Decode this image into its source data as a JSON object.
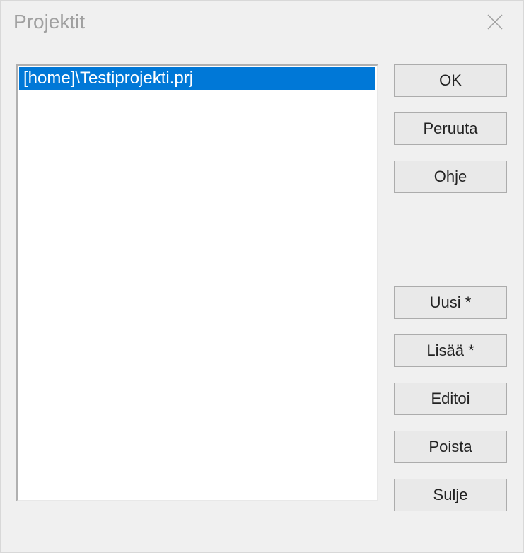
{
  "title": "Projektit",
  "list": {
    "items": [
      {
        "label": "[home]\\Testiprojekti.prj",
        "selected": true
      }
    ]
  },
  "buttons": {
    "ok": "OK",
    "cancel": "Peruuta",
    "help": "Ohje",
    "new": "Uusi *",
    "add": "Lisää *",
    "edit": "Editoi",
    "remove": "Poista",
    "close": "Sulje"
  }
}
